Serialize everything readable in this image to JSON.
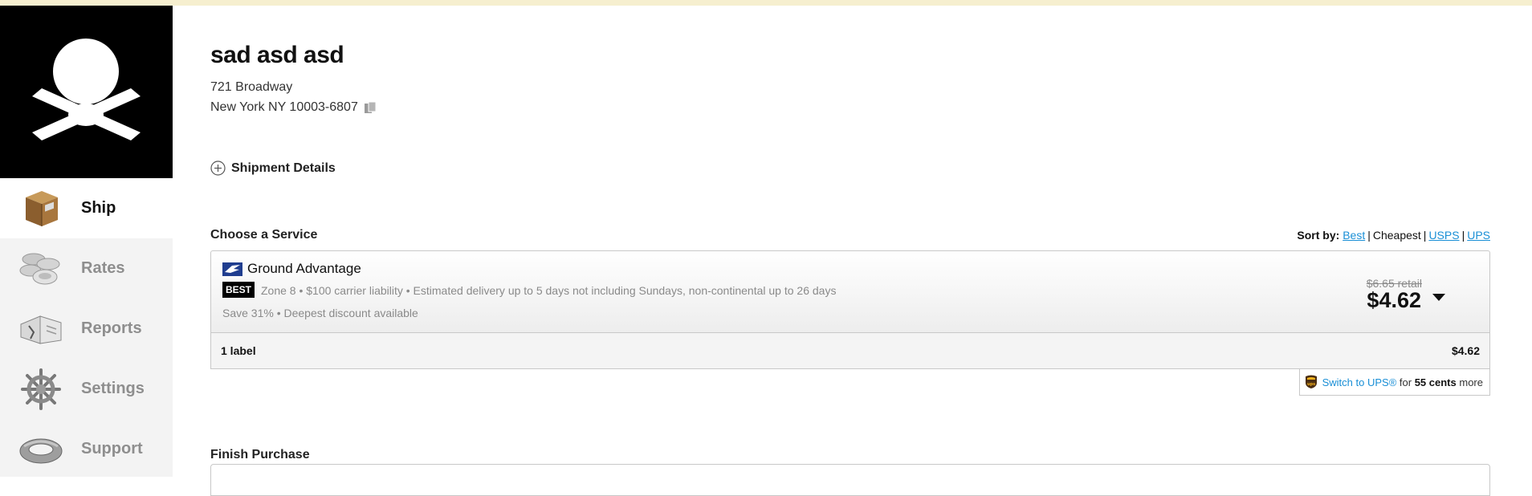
{
  "sidebar": {
    "items": [
      {
        "label": "Ship",
        "icon": "shipping-box-icon",
        "active": true
      },
      {
        "label": "Rates",
        "icon": "coins-icon",
        "active": false
      },
      {
        "label": "Reports",
        "icon": "open-book-icon",
        "active": false
      },
      {
        "label": "Settings",
        "icon": "ship-wheel-icon",
        "active": false
      },
      {
        "label": "Support",
        "icon": "life-ring-icon",
        "active": false
      }
    ]
  },
  "recipient": {
    "name": "sad asd asd",
    "address_line1": "721 Broadway",
    "address_line2": "New York NY 10003-6807"
  },
  "shipment_details": {
    "label": "Shipment Details"
  },
  "choose_service": {
    "title": "Choose a Service",
    "sort": {
      "label": "Sort by:",
      "options": [
        "Best",
        "Cheapest",
        "USPS",
        "UPS"
      ]
    },
    "service": {
      "carrier_icon": "usps-eagle-icon",
      "name": "Ground Advantage",
      "badge": "BEST",
      "description": "Zone 8 • $100 carrier liability • Estimated delivery up to 5 days not including Sundays, non-continental up to 26 days",
      "savings": "Save 31% • Deepest discount available",
      "retail": "$6.65 retail",
      "price": "$4.62"
    },
    "labels_summary": {
      "count": "1 label",
      "total": "$4.62"
    },
    "ups_switch": {
      "link": "Switch to UPS®",
      "text_for": "for",
      "amount": "55 cents",
      "text_more": "more"
    }
  },
  "finish_purchase": {
    "title": "Finish Purchase"
  },
  "colors": {
    "accent_link": "#1a8fd6",
    "top_banner": "#f6efcf",
    "sidebar_bg": "#f3f3f3"
  }
}
